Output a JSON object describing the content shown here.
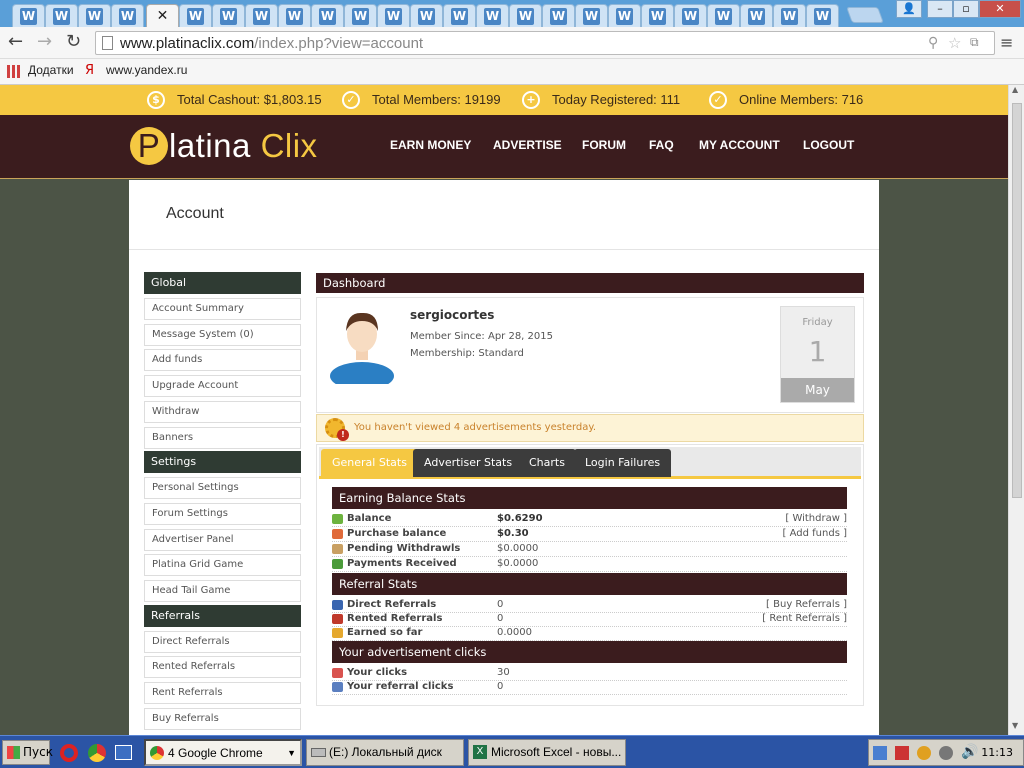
{
  "browser": {
    "tab_letter": "W",
    "close_glyph": "✕",
    "url_host": "www.platinaclix.com",
    "url_path": "/index.php?view=account",
    "bookmarks": [
      {
        "label": "Додатки"
      },
      {
        "label": "www.yandex.ru"
      }
    ],
    "window_buttons": {
      "profile": "👤",
      "minimize": "–",
      "restore": "▫",
      "close": "✕"
    }
  },
  "site": {
    "stats": [
      {
        "icon": "$",
        "label": "Total Cashout: $1,803.15"
      },
      {
        "icon": "✓",
        "label": "Total Members: 19199"
      },
      {
        "icon": "+",
        "label": "Today Registered: 111"
      },
      {
        "icon": "✓",
        "label": "Online Members: 716"
      }
    ],
    "logo": {
      "letter": "P",
      "first": "latina",
      "second": "Clix"
    },
    "nav": [
      "EARN MONEY",
      "ADVERTISE",
      "FORUM",
      "FAQ",
      "MY ACCOUNT",
      "LOGOUT"
    ],
    "page_title": "Account"
  },
  "sidebar": {
    "global_title": "Global",
    "global_items": [
      "Account Summary",
      "Message System (0)",
      "Add funds",
      "Upgrade Account",
      "Withdraw",
      "Banners"
    ],
    "settings_title": "Settings",
    "settings_items": [
      "Personal Settings",
      "Forum Settings",
      "Advertiser Panel",
      "Platina Grid Game",
      "Head Tail Game"
    ],
    "referrals_title": "Referrals",
    "referrals_items": [
      "Direct Referrals",
      "Rented Referrals",
      "Rent Referrals",
      "Buy Referrals"
    ]
  },
  "dashboard": {
    "title": "Dashboard",
    "username": "sergiocortes",
    "member_since": "Member Since: Apr 28, 2015",
    "membership": "Membership: Standard",
    "date": {
      "weekday": "Friday",
      "day": "1",
      "month": "May"
    },
    "warning": "You haven't viewed 4 advertisements yesterday.",
    "tabs": [
      "General Stats",
      "Advertiser Stats",
      "Charts",
      "Login Failures"
    ],
    "earning_title": "Earning Balance Stats",
    "earning_rows": [
      {
        "label": "Balance",
        "value": "$0.6290",
        "link": "[ Withdraw ]"
      },
      {
        "label": "Purchase balance",
        "value": "$0.30",
        "link": "[ Add funds ]"
      },
      {
        "label": "Pending Withdrawls",
        "value": "$0.0000",
        "link": ""
      },
      {
        "label": "Payments Received",
        "value": "$0.0000",
        "link": ""
      }
    ],
    "referral_title": "Referral Stats",
    "referral_rows": [
      {
        "label": "Direct Referrals",
        "value": "0",
        "link": "[ Buy Referrals ]"
      },
      {
        "label": "Rented Referrals",
        "value": "0",
        "link": "[ Rent Referrals ]"
      },
      {
        "label": "Earned so far",
        "value": "0.0000",
        "link": ""
      }
    ],
    "clicks_title": "Your advertisement clicks",
    "clicks_rows": [
      {
        "label": "Your clicks",
        "value": "30"
      },
      {
        "label": "Your referral clicks",
        "value": "0"
      }
    ]
  },
  "taskbar": {
    "start": "Пуск",
    "buttons": [
      "4 Google Chrome",
      "(E:) Локальный диск",
      "Microsoft Excel - новы..."
    ],
    "clock": "11:13"
  },
  "colors": {
    "accent": "#f5c842",
    "header": "#3b1c1e",
    "sidebar_head": "#2f3b33"
  }
}
